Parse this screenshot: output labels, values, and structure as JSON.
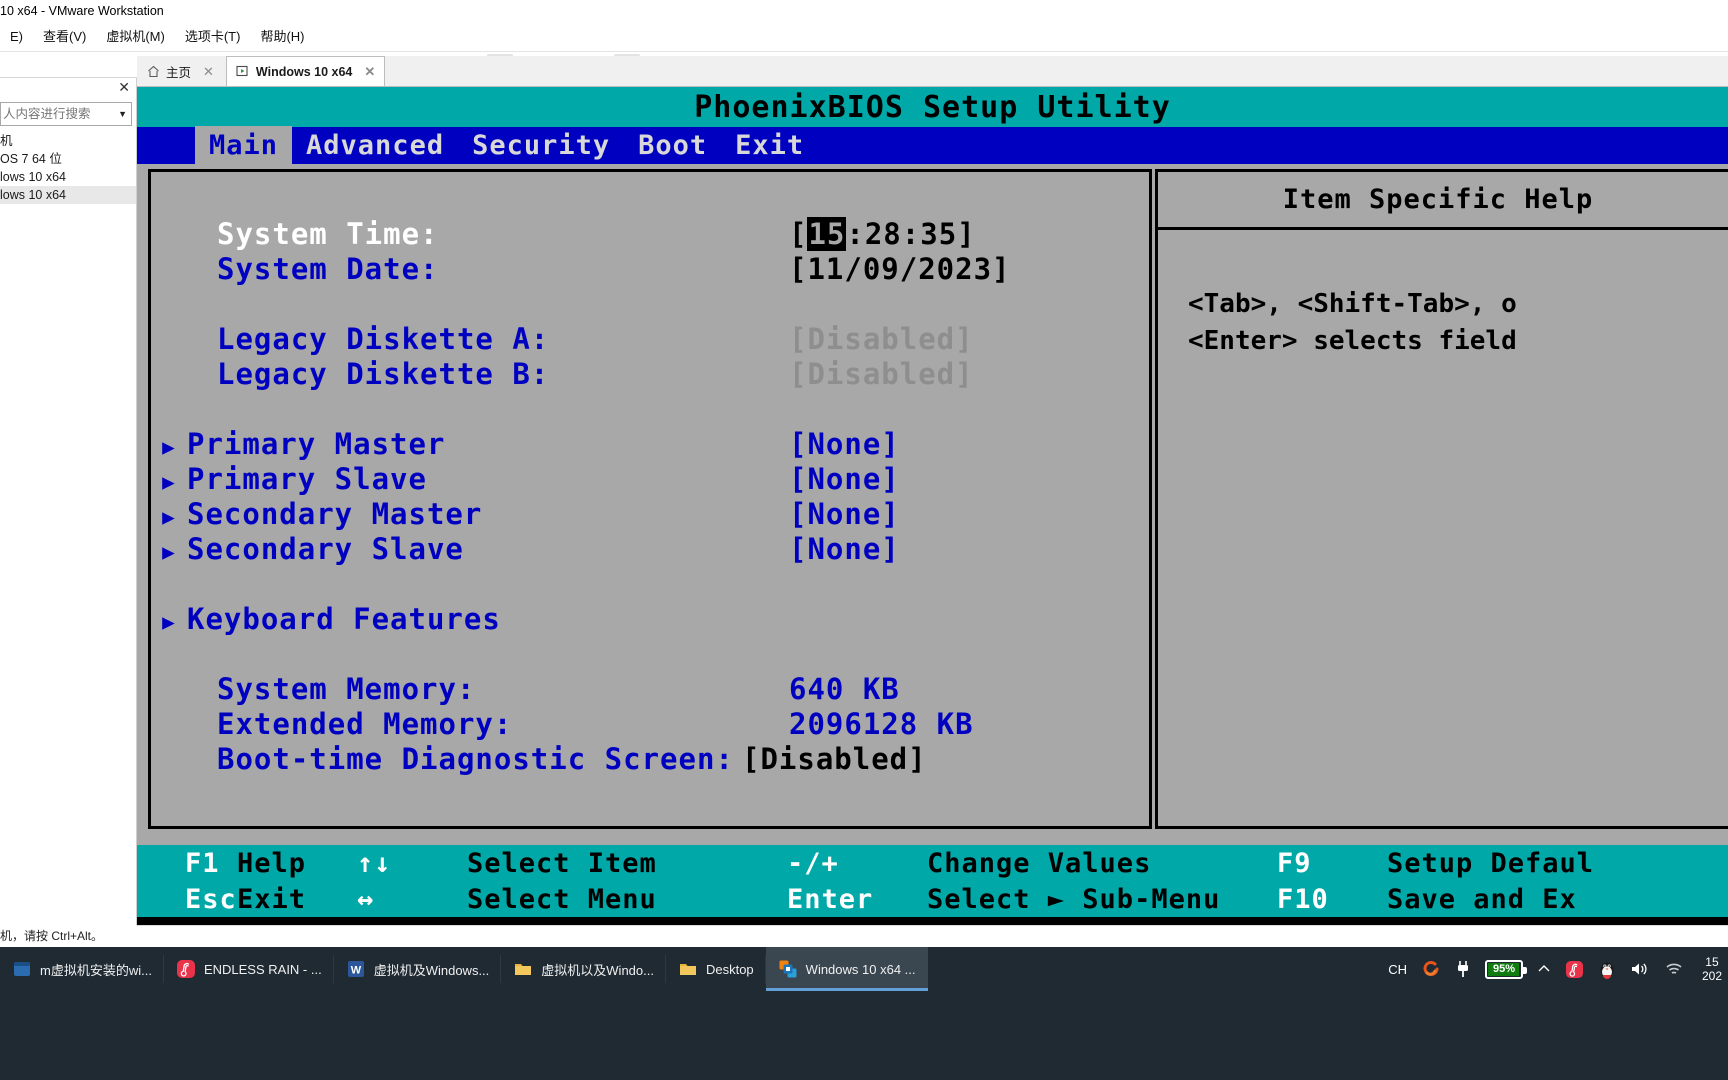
{
  "window": {
    "title": "10 x64 - VMware Workstation"
  },
  "menubar": {
    "items": [
      "E)",
      "查看(V)",
      "虚拟机(M)",
      "选项卡(T)",
      "帮助(H)"
    ]
  },
  "toolbar": {
    "buttons": [
      {
        "name": "pause-button",
        "icon": "pause-icon"
      },
      {
        "name": "pause-dropdown",
        "icon": "chevron-down-icon"
      },
      {
        "name": "send-ctrl-alt-del-button",
        "icon": "keyboard-send-icon"
      },
      {
        "name": "snapshot-take-button",
        "icon": "snapshot-add-icon"
      },
      {
        "name": "snapshot-revert-button",
        "icon": "snapshot-revert-icon"
      },
      {
        "name": "snapshot-manager-button",
        "icon": "snapshot-manager-icon"
      },
      {
        "name": "show-library-button",
        "icon": "panel-left-icon"
      },
      {
        "name": "show-thumbnail-bar-button",
        "icon": "panel-bottom-icon"
      },
      {
        "name": "enter-fullscreen-button",
        "icon": "fullscreen-icon"
      },
      {
        "name": "unity-mode-button",
        "icon": "unity-off-icon"
      },
      {
        "name": "console-button",
        "icon": "terminal-icon"
      },
      {
        "name": "console-dropdown",
        "icon": "chevron-down-icon"
      }
    ]
  },
  "sidebar": {
    "search_value": "",
    "search_placeholder": "人内容进行搜索",
    "close_label": "✕",
    "items": [
      {
        "label": "机"
      },
      {
        "label": "OS 7 64 位"
      },
      {
        "label": "lows 10 x64"
      },
      {
        "label": "lows 10 x64",
        "selected": true
      }
    ],
    "status": "机，请按 Ctrl+Alt。"
  },
  "tabs": [
    {
      "label": "主页",
      "icon": "home-icon",
      "active": false,
      "closable": true
    },
    {
      "label": "Windows 10 x64",
      "icon": "vm-play-icon",
      "active": true,
      "closable": true
    }
  ],
  "bios": {
    "title": "PhoenixBIOS Setup Utility",
    "menu": [
      {
        "label": "Main",
        "selected": true
      },
      {
        "label": "Advanced",
        "selected": false
      },
      {
        "label": "Security",
        "selected": false
      },
      {
        "label": "Boot",
        "selected": false
      },
      {
        "label": "Exit",
        "selected": false
      }
    ],
    "rows": [
      {
        "type": "item",
        "arrow": false,
        "label": "System Time:",
        "highlight": true,
        "value_prefix": "[",
        "value_cursor": "15",
        "value_suffix": ":28:35]",
        "style": "black"
      },
      {
        "type": "item",
        "arrow": false,
        "label": "System Date:",
        "value": "[11/09/2023]",
        "style": "black"
      },
      {
        "type": "spacer"
      },
      {
        "type": "item",
        "arrow": false,
        "label": "Legacy Diskette A:",
        "value": "[Disabled]",
        "style": "dim"
      },
      {
        "type": "item",
        "arrow": false,
        "label": "Legacy Diskette B:",
        "value": "[Disabled]",
        "style": "dim"
      },
      {
        "type": "spacer"
      },
      {
        "type": "item",
        "arrow": true,
        "label": "Primary Master",
        "value": "[None]",
        "style": "blue"
      },
      {
        "type": "item",
        "arrow": true,
        "label": "Primary Slave",
        "value": "[None]",
        "style": "blue"
      },
      {
        "type": "item",
        "arrow": true,
        "label": "Secondary Master",
        "value": "[None]",
        "style": "blue"
      },
      {
        "type": "item",
        "arrow": true,
        "label": "Secondary Slave",
        "value": "[None]",
        "style": "blue"
      },
      {
        "type": "spacer"
      },
      {
        "type": "item",
        "arrow": true,
        "label": "Keyboard Features",
        "value": "",
        "style": "blue"
      },
      {
        "type": "spacer"
      },
      {
        "type": "item",
        "arrow": false,
        "label": "System Memory:",
        "value": "640 KB",
        "style": "blue"
      },
      {
        "type": "item",
        "arrow": false,
        "label": "Extended Memory:",
        "value": "2096128 KB",
        "style": "blue"
      },
      {
        "type": "item",
        "arrow": false,
        "label": "Boot-time Diagnostic Screen:",
        "value": "[Disabled]",
        "style": "black",
        "wide": true
      }
    ],
    "help": {
      "title": "Item Specific Help",
      "lines": [
        "<Tab>, <Shift-Tab>, o",
        "<Enter> selects field"
      ]
    },
    "keys": [
      {
        "key": "F1",
        "desc": "Help",
        "key2": "↑↓",
        "desc2": "Select Item",
        "key3": "-/+",
        "desc3": "Change Values",
        "key4": "F9",
        "desc4": "Setup Defaul"
      },
      {
        "key": "Esc",
        "desc": "Exit",
        "key2": "↔",
        "desc2": "Select Menu",
        "key3": "Enter",
        "desc3": "Select ► Sub-Menu",
        "key4": "F10",
        "desc4": "Save and Ex"
      }
    ]
  },
  "taskbar": {
    "apps": [
      {
        "label": "m虚拟机安装的wi...",
        "icon": "window-icon",
        "color": "#2b6cb0",
        "active": false
      },
      {
        "label": "ENDLESS RAIN - ...",
        "icon": "netease-music-icon",
        "color": "#e8334a",
        "active": false
      },
      {
        "label": "虚拟机及Windows...",
        "icon": "word-icon",
        "color": "#2b579a",
        "active": false
      },
      {
        "label": "虚拟机以及Windo...",
        "icon": "folder-icon",
        "color": "#e8b339",
        "active": false
      },
      {
        "label": "Desktop",
        "icon": "folder-icon",
        "color": "#e8b339",
        "active": false
      },
      {
        "label": "Windows 10 x64 ...",
        "icon": "vmware-icon",
        "color": "#f0820f",
        "active": true
      }
    ],
    "tray": {
      "ime": "CH",
      "sogou": "sogou-icon",
      "plug": "power-plug-icon",
      "battery_percent": "95%",
      "chevron": "chevron-up-icon",
      "netease": "netease-music-icon",
      "qq": "qq-penguin-icon",
      "volume": "speaker-icon",
      "wifi": "wifi-icon",
      "time": "15",
      "date": "202"
    }
  }
}
